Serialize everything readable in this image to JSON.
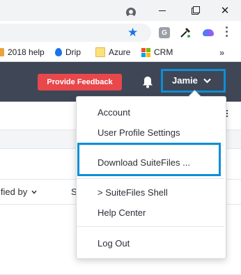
{
  "browser": {
    "window_controls": {
      "minimize": "",
      "restore": "",
      "close": "✕"
    },
    "bookmarks": [
      {
        "label": "2018 help"
      },
      {
        "label": "Drip"
      },
      {
        "label": "Azure"
      },
      {
        "label": "CRM"
      }
    ],
    "more_bookmarks": "»",
    "extension_g_label": "G"
  },
  "header": {
    "feedback_label": "Provide Feedback",
    "user_name": "Jamie"
  },
  "table": {
    "modified_by_label": "ified by",
    "next_col_label": "S"
  },
  "user_menu": {
    "items": [
      {
        "label": "Account"
      },
      {
        "label": "User Profile Settings"
      },
      {
        "label": "Download SuiteFiles ..."
      },
      {
        "label": "> SuiteFiles Shell"
      },
      {
        "label": "Help Center"
      },
      {
        "label": "Log Out"
      }
    ]
  },
  "colors": {
    "header_bg": "#3f4656",
    "feedback_button": "#e8474c",
    "highlight_box": "#0b8fd6"
  }
}
